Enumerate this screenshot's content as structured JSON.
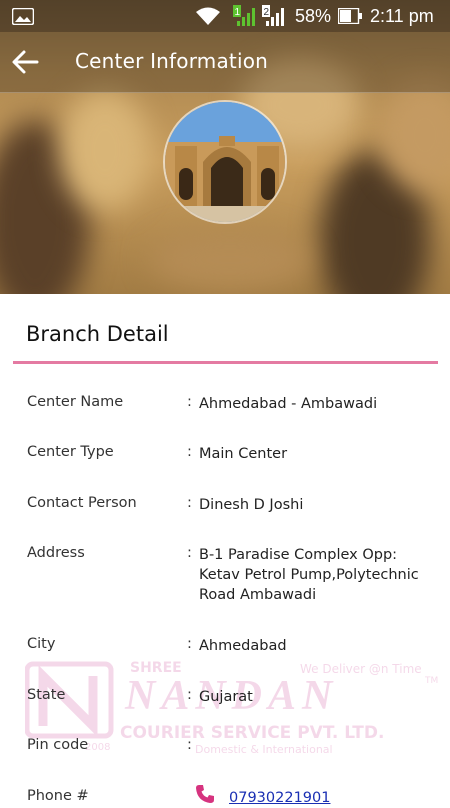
{
  "status_bar": {
    "battery": "58%",
    "time": "2:11 pm"
  },
  "header": {
    "title": "Center Information"
  },
  "card": {
    "title": "Branch Detail"
  },
  "fields": [
    {
      "label": "Center Name",
      "value": "Ahmedabad - Ambawadi"
    },
    {
      "label": "Center Type",
      "value": "Main Center"
    },
    {
      "label": "Contact Person",
      "value": "Dinesh D Joshi"
    },
    {
      "label": "Address",
      "value": "B-1 Paradise Complex Opp: Ketav Petrol Pump,Polytechnic Road Ambawadi"
    },
    {
      "label": "City",
      "value": "Ahmedabad"
    },
    {
      "label": "State",
      "value": "Gujarat"
    },
    {
      "label": "Pin code",
      "value": ""
    },
    {
      "label": "Phone #",
      "value": "07930221901"
    }
  ],
  "separator": ":",
  "watermark": {
    "top": "SHREE",
    "brand": "NANDAN",
    "tagline": "We Deliver @n Time",
    "company": "COURIER SERVICE PVT. LTD.",
    "sub": "Domestic & International",
    "year": "2008",
    "tm": "TM"
  },
  "colors": {
    "accent_rule": "#e47aa2",
    "link": "#1a2fb3"
  }
}
